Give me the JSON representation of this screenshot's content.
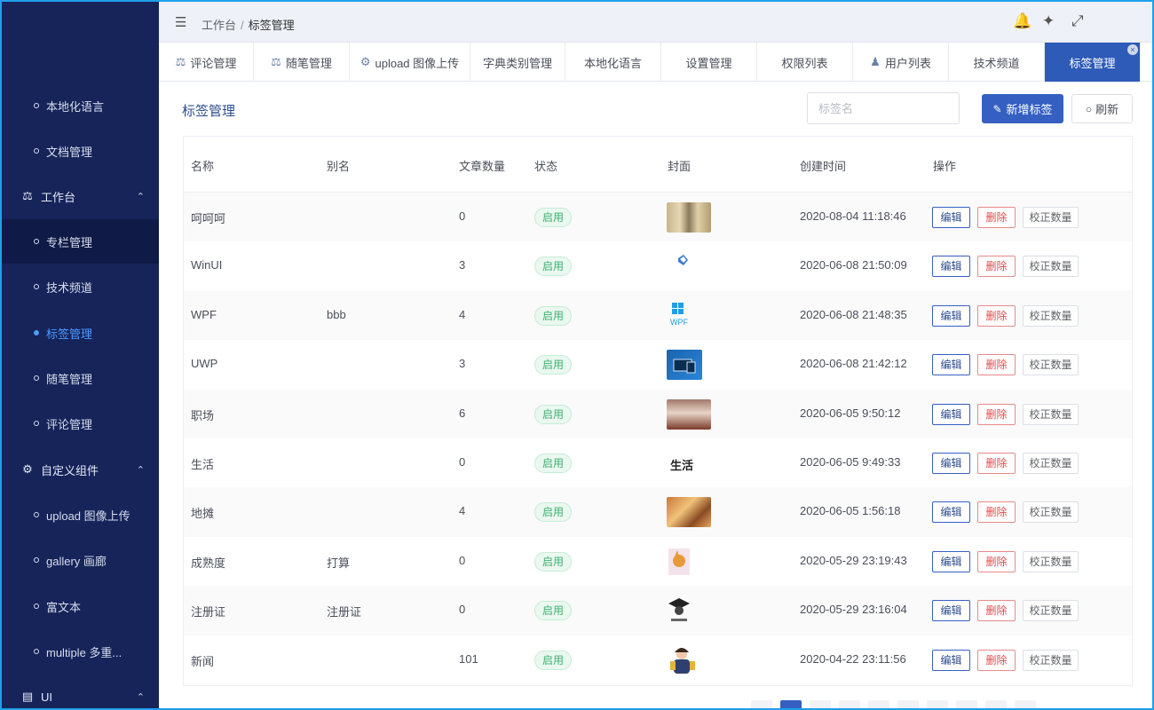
{
  "sidebar": {
    "items": [
      {
        "label": "本地化语言",
        "type": "sub"
      },
      {
        "label": "文档管理",
        "type": "sub"
      },
      {
        "label": "工作台",
        "type": "group",
        "icon": "dashboard-icon"
      },
      {
        "label": "专栏管理",
        "type": "sub"
      },
      {
        "label": "技术频道",
        "type": "sub"
      },
      {
        "label": "标签管理",
        "type": "sub",
        "active": true
      },
      {
        "label": "随笔管理",
        "type": "sub"
      },
      {
        "label": "评论管理",
        "type": "sub"
      },
      {
        "label": "自定义组件",
        "type": "group",
        "icon": "gear-icon"
      },
      {
        "label": "upload 图像上传",
        "type": "sub"
      },
      {
        "label": "gallery 画廊",
        "type": "sub"
      },
      {
        "label": "富文本",
        "type": "sub"
      },
      {
        "label": "multiple 多重...",
        "type": "sub"
      },
      {
        "label": "UI",
        "type": "group",
        "icon": "table-icon"
      }
    ]
  },
  "header": {
    "breadcrumb": [
      "工作台",
      "标签管理"
    ]
  },
  "tabs": [
    {
      "label": "评论管理",
      "icon": "dashboard-icon"
    },
    {
      "label": "随笔管理",
      "icon": "dashboard-icon"
    },
    {
      "label": "upload 图像上传",
      "icon": "gear-icon"
    },
    {
      "label": "字典类别管理"
    },
    {
      "label": "本地化语言"
    },
    {
      "label": "设置管理"
    },
    {
      "label": "权限列表"
    },
    {
      "label": "用户列表",
      "icon": "user-icon"
    },
    {
      "label": "技术频道"
    },
    {
      "label": "标签管理",
      "active": true,
      "closable": true
    }
  ],
  "main": {
    "title": "标签管理",
    "search_placeholder": "标签名",
    "add_label": "新增标签",
    "refresh_label": "刷新"
  },
  "table": {
    "columns": [
      "名称",
      "别名",
      "文章数量",
      "状态",
      "封面",
      "创建时间",
      "操作"
    ],
    "actions": {
      "edit": "编辑",
      "delete": "删除",
      "fix": "校正数量"
    },
    "rows": [
      {
        "name": "呵呵呵",
        "alias": "",
        "count": "0",
        "status": "启用",
        "created": "2020-08-04 11:18:46",
        "cover": "palace-photo"
      },
      {
        "name": "WinUI",
        "alias": "",
        "count": "3",
        "status": "启用",
        "created": "2020-06-08 21:50:09",
        "cover": "winui-logo"
      },
      {
        "name": "WPF",
        "alias": "bbb",
        "count": "4",
        "status": "启用",
        "created": "2020-06-08 21:48:35",
        "cover": "wpf-logo",
        "cover_text": "WPF"
      },
      {
        "name": "UWP",
        "alias": "",
        "count": "3",
        "status": "启用",
        "created": "2020-06-08 21:42:12",
        "cover": "uwp-devices"
      },
      {
        "name": "职场",
        "alias": "",
        "count": "6",
        "status": "启用",
        "created": "2020-06-05 9:50:12",
        "cover": "office-photo"
      },
      {
        "name": "生活",
        "alias": "",
        "count": "0",
        "status": "启用",
        "created": "2020-06-05 9:49:33",
        "cover": "calligraphy",
        "cover_text": "生活"
      },
      {
        "name": "地摊",
        "alias": "",
        "count": "4",
        "status": "启用",
        "created": "2020-06-05 1:56:18",
        "cover": "street-market-photo"
      },
      {
        "name": "成熟度",
        "alias": "打算",
        "count": "0",
        "status": "启用",
        "created": "2020-05-29 23:19:43",
        "cover": "fox-illustration"
      },
      {
        "name": "注册证",
        "alias": "注册证",
        "count": "0",
        "status": "启用",
        "created": "2020-05-29 23:16:04",
        "cover": "graduate-icon"
      },
      {
        "name": "新闻",
        "alias": "",
        "count": "101",
        "status": "启用",
        "created": "2020-04-22 23:11:56",
        "cover": "reporter-illustration"
      }
    ]
  },
  "colors": {
    "sidebar_bg": "#16245a",
    "accent": "#3560c2",
    "status_green": "#3fb070",
    "delete_red": "#e04b4b"
  }
}
